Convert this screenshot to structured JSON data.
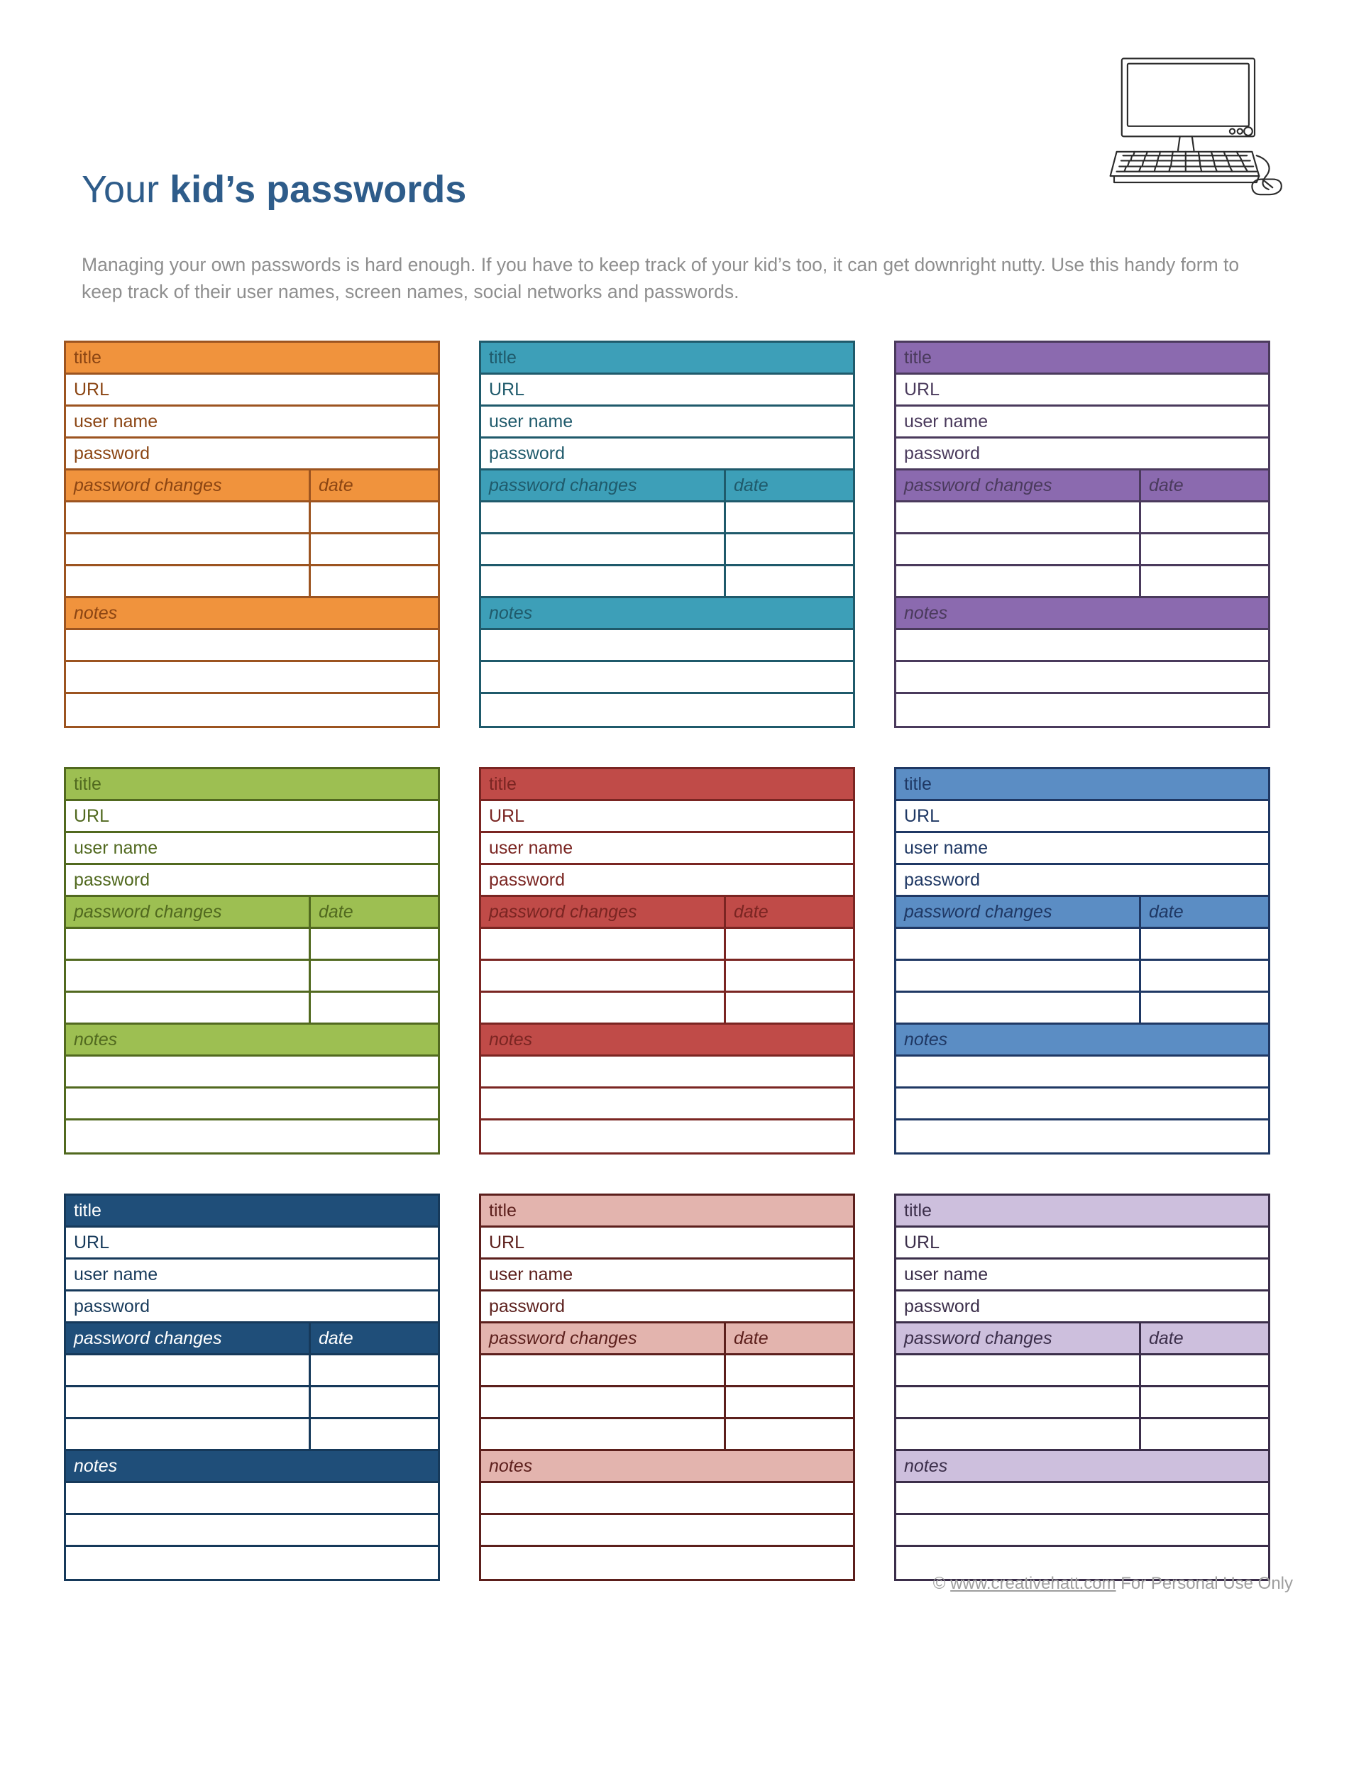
{
  "header": {
    "title_light": "Your ",
    "title_bold": "kid’s passwords",
    "intro": "Managing your own passwords is hard enough. If you have to keep track of your kid’s too, it can get downright nutty. Use this handy form to keep track of their user names, screen names, social networks and passwords.",
    "illustration_name": "desktop-computer-illustration",
    "title_color": "#2E5C8A",
    "intro_color": "#8E8E8E"
  },
  "card_labels": {
    "title": "title",
    "url": "URL",
    "user_name": "user name",
    "password": "password",
    "password_changes": "password changes",
    "date": "date",
    "notes": "notes",
    "blank": ""
  },
  "cards": [
    {
      "id": "card-orange",
      "color_name": "orange",
      "accent": "#F0933D",
      "line": "#9C5420",
      "text": "#8B4513"
    },
    {
      "id": "card-teal",
      "color_name": "teal",
      "accent": "#3D9FB8",
      "line": "#1F5A6B",
      "text": "#1F5A6B"
    },
    {
      "id": "card-purple",
      "color_name": "purple",
      "accent": "#8B6AAF",
      "line": "#4A3A5C",
      "text": "#4A3A5C"
    },
    {
      "id": "card-green",
      "color_name": "green",
      "accent": "#9DBF52",
      "line": "#51691F",
      "text": "#51691F"
    },
    {
      "id": "card-red",
      "color_name": "red",
      "accent": "#C04B48",
      "line": "#7A2522",
      "text": "#7A2522"
    },
    {
      "id": "card-blue",
      "color_name": "blue",
      "accent": "#5B8DC4",
      "line": "#1F3864",
      "text": "#1F3864"
    },
    {
      "id": "card-navy",
      "color_name": "navy",
      "accent": "#1F4E79",
      "line": "#16395A",
      "text": "#FFFFFF",
      "body_text": "#16395A"
    },
    {
      "id": "card-salmon",
      "color_name": "salmon",
      "accent": "#E3B4AE",
      "line": "#5C1F1C",
      "text": "#5C1F1C"
    },
    {
      "id": "card-lavender",
      "color_name": "lavender",
      "accent": "#CDBFDD",
      "line": "#3B2E4A",
      "text": "#3B2E4A"
    }
  ],
  "footer": {
    "copyright_symbol": "© ",
    "site": "www.creativehatt.com",
    "usage": " For Personal Use Only",
    "color": "#9E9E9E"
  }
}
